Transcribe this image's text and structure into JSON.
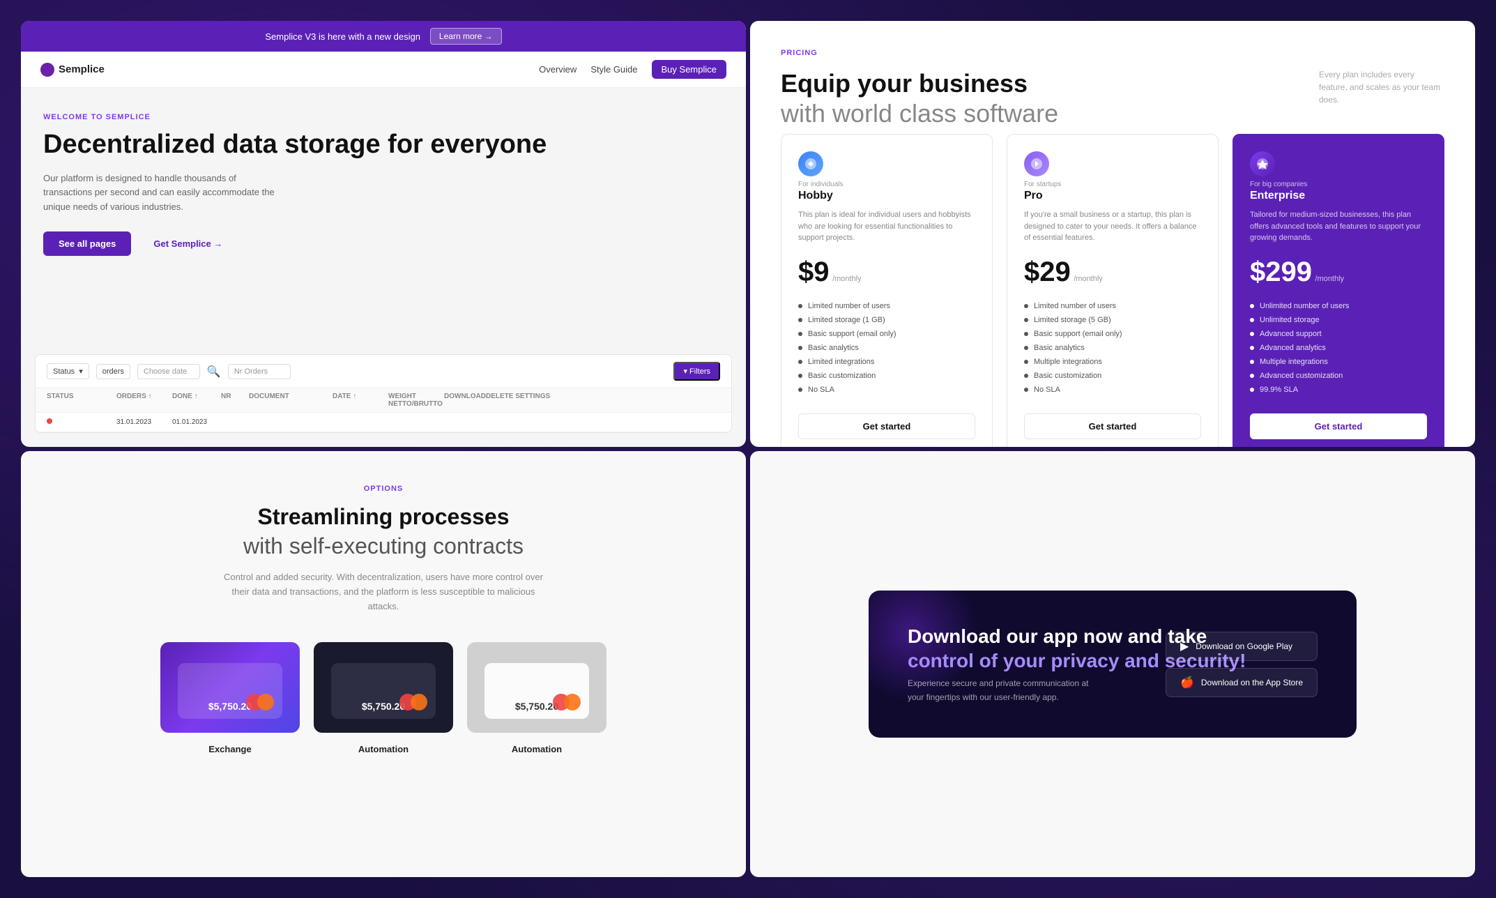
{
  "hero": {
    "announcement": "Semplice V3 is here with a new design",
    "learn_more": "Learn more →",
    "logo": "Semplice",
    "nav": {
      "overview": "Overview",
      "style_guide": "Style Guide",
      "buy": "Buy Semplice"
    },
    "label": "WELCOME TO SEMPLICE",
    "title": "Decentralized data storage for everyone",
    "subtitle": "Our platform is designed to handle thousands of transactions per second and can easily accommodate the unique needs of various industries.",
    "btn_all_pages": "See all pages",
    "btn_semplice": "Get Semplice →",
    "table": {
      "filter_btn": "▾ Filters",
      "status_label": "Status",
      "orders_label": "orders",
      "date_placeholder": "Choose date",
      "nr_orders_placeholder": "Nr Orders",
      "columns": [
        "Status",
        "Orders ↑",
        "Done ↑",
        "Nr",
        "Document",
        "Date ↑",
        "Weight netto/brutto",
        "Download",
        "Edit  Delete Settings"
      ],
      "rows": [
        [
          "",
          "31.01.2023",
          "01.01.2023",
          "",
          "",
          "",
          "",
          "",
          ""
        ]
      ]
    }
  },
  "pricing": {
    "label": "PRICING",
    "title_line1": "Equip your business",
    "title_line2": "with world class software",
    "subtitle": "Every plan includes every feature, and scales as your team does.",
    "plans": [
      {
        "tier_label": "For individuals",
        "name": "Hobby",
        "description": "This plan is ideal for individual users and hobbyists who are looking for essential functionalities to support projects.",
        "price": "$9",
        "period": "/monthly",
        "features": [
          "Limited number of users",
          "Limited storage (1 GB)",
          "Basic support (email only)",
          "Basic analytics",
          "Limited integrations",
          "Basic customization",
          "No SLA"
        ],
        "cta": "Get started",
        "featured": false
      },
      {
        "tier_label": "For startups",
        "name": "Pro",
        "description": "If you're a small business or a startup, this plan is designed to cater to your needs. It offers a balance of essential features.",
        "price": "$29",
        "period": "/monthly",
        "features": [
          "Limited number of users",
          "Limited storage (5 GB)",
          "Basic support (email only)",
          "Basic analytics",
          "Multiple integrations",
          "Basic customization",
          "No SLA"
        ],
        "cta": "Get started",
        "featured": false
      },
      {
        "tier_label": "For big companies",
        "name": "Enterprise",
        "description": "Tailored for medium-sized businesses, this plan offers advanced tools and features to support your growing demands.",
        "price": "$299",
        "period": "/monthly",
        "features": [
          "Unlimited number of users",
          "Unlimited storage",
          "Advanced support",
          "Advanced analytics",
          "Multiple integrations",
          "Advanced customization",
          "99.9% SLA"
        ],
        "cta": "Get started",
        "featured": true
      }
    ]
  },
  "options": {
    "label": "OPTIONS",
    "title_line1": "Streamlining processes",
    "title_line2": "with self-executing contracts",
    "subtitle": "Control and added security. With decentralization, users have more control over their data and transactions, and the platform is less susceptible to malicious attacks.",
    "cards": [
      {
        "label": "Exchange",
        "amount": "$5,750.20"
      },
      {
        "label": "Automation",
        "amount": "$5,750.20"
      },
      {
        "label": "Automation",
        "amount": "$5,750.20"
      }
    ]
  },
  "download": {
    "title_line1": "Download our app now and take",
    "title_line2": "control of your privacy and security!",
    "description": "Experience secure and private communication at your fingertips with our user-friendly app.",
    "btn_google": "Download on Google Play",
    "btn_apple": "Download on the App Store"
  }
}
